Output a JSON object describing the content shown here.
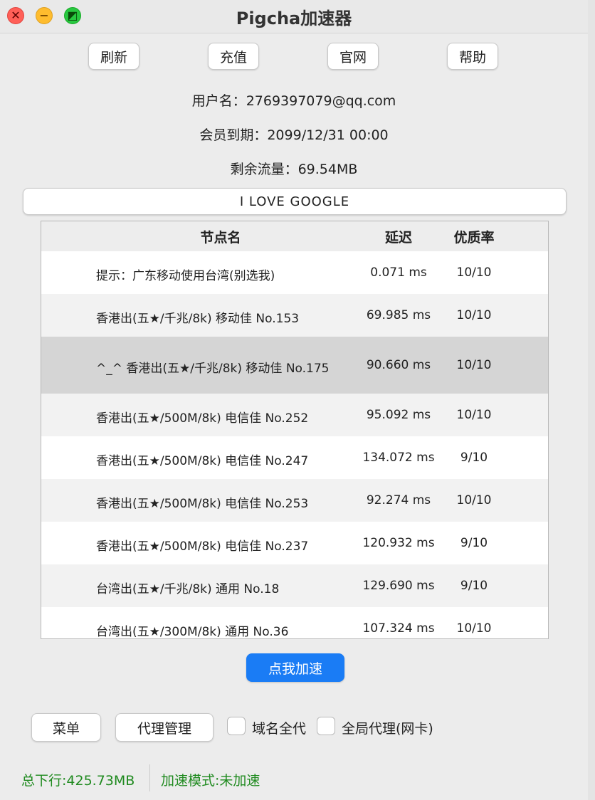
{
  "window": {
    "title": "Pigcha加速器",
    "close_glyph": "✕",
    "min_glyph": "−",
    "max_glyph": "◩"
  },
  "toolbar": {
    "refresh": "刷新",
    "recharge": "充值",
    "website": "官网",
    "help": "帮助"
  },
  "account": {
    "username_label": "用户名：",
    "username": "2769397079@qq.com",
    "expiry_label": "会员到期：",
    "expiry": "2099/12/31 00:00",
    "traffic_label": "剩余流量：",
    "traffic": "69.54MB"
  },
  "banner_button": "I LOVE GOOGLE",
  "table": {
    "headers": {
      "name": "节点名",
      "latency": "延迟",
      "quality": "优质率"
    },
    "rows": [
      {
        "name": "提示：广东移动使用台湾(别选我)",
        "latency": "0.071 ms",
        "quality": "10/10"
      },
      {
        "name": "香港出(五★/千兆/8k) 移动佳 No.153",
        "latency": "69.985 ms",
        "quality": "10/10"
      },
      {
        "name": "^_^ 香港出(五★/千兆/8k) 移动佳 No.175",
        "latency": "90.660 ms",
        "quality": "10/10"
      },
      {
        "name": "香港出(五★/500M/8k) 电信佳 No.252",
        "latency": "95.092 ms",
        "quality": "10/10"
      },
      {
        "name": "香港出(五★/500M/8k) 电信佳 No.247",
        "latency": "134.072 ms",
        "quality": "9/10"
      },
      {
        "name": "香港出(五★/500M/8k) 电信佳 No.253",
        "latency": "92.274 ms",
        "quality": "10/10"
      },
      {
        "name": "香港出(五★/500M/8k) 电信佳 No.237",
        "latency": "120.932 ms",
        "quality": "9/10"
      },
      {
        "name": "台湾出(五★/千兆/8k) 通用 No.18",
        "latency": "129.690 ms",
        "quality": "9/10"
      },
      {
        "name": "台湾出(五★/300M/8k) 通用 No.36",
        "latency": "107.324 ms",
        "quality": "10/10"
      }
    ]
  },
  "accelerate_button": "点我加速",
  "bottom": {
    "menu": "菜单",
    "proxy_manage": "代理管理",
    "domain_proxy": "域名全代",
    "global_proxy": "全局代理(网卡)"
  },
  "status": {
    "download": "总下行:425.73MB",
    "mode": "加速模式:未加速"
  },
  "colors": {
    "accent": "#1a7cf5",
    "status_text": "#1f8a1f",
    "selected_row": "#d5d5d5"
  }
}
